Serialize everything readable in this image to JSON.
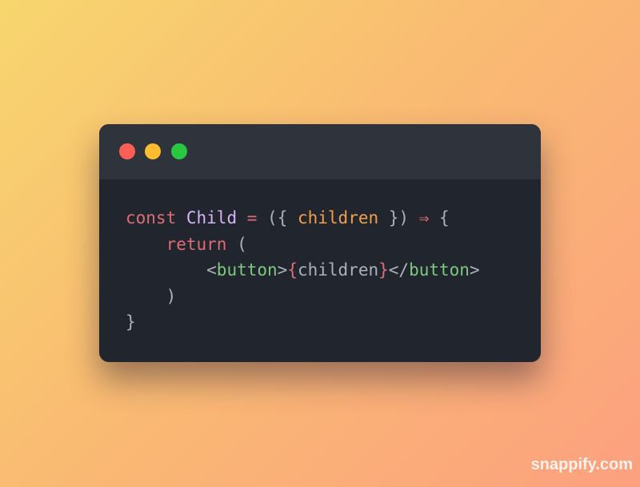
{
  "window": {
    "controls": [
      {
        "name": "close",
        "color": "#ff5f57"
      },
      {
        "name": "minimize",
        "color": "#febc2e"
      },
      {
        "name": "maximize",
        "color": "#28c840"
      }
    ]
  },
  "code": {
    "lines": [
      [
        {
          "text": "const",
          "color": "#e06c75"
        },
        {
          "text": " ",
          "color": "#abb2bf"
        },
        {
          "text": "Child",
          "color": "#d6b4f7"
        },
        {
          "text": " ",
          "color": "#abb2bf"
        },
        {
          "text": "=",
          "color": "#e06c75"
        },
        {
          "text": " ({ ",
          "color": "#abb2bf"
        },
        {
          "text": "children",
          "color": "#f0a04b"
        },
        {
          "text": " }) ",
          "color": "#abb2bf"
        },
        {
          "text": "⇒",
          "color": "#e06c75"
        },
        {
          "text": " {",
          "color": "#abb2bf"
        }
      ],
      [
        {
          "text": "    ",
          "color": "#abb2bf"
        },
        {
          "text": "return",
          "color": "#e06c75"
        },
        {
          "text": " (",
          "color": "#abb2bf"
        }
      ],
      [
        {
          "text": "        <",
          "color": "#abb2bf"
        },
        {
          "text": "button",
          "color": "#7ec97e"
        },
        {
          "text": ">",
          "color": "#abb2bf"
        },
        {
          "text": "{",
          "color": "#e06c75"
        },
        {
          "text": "children",
          "color": "#abb2bf"
        },
        {
          "text": "}",
          "color": "#e06c75"
        },
        {
          "text": "</",
          "color": "#abb2bf"
        },
        {
          "text": "button",
          "color": "#7ec97e"
        },
        {
          "text": ">",
          "color": "#abb2bf"
        }
      ],
      [
        {
          "text": "    )",
          "color": "#abb2bf"
        }
      ],
      [
        {
          "text": "}",
          "color": "#abb2bf"
        }
      ]
    ]
  },
  "watermark": "snappify.com"
}
